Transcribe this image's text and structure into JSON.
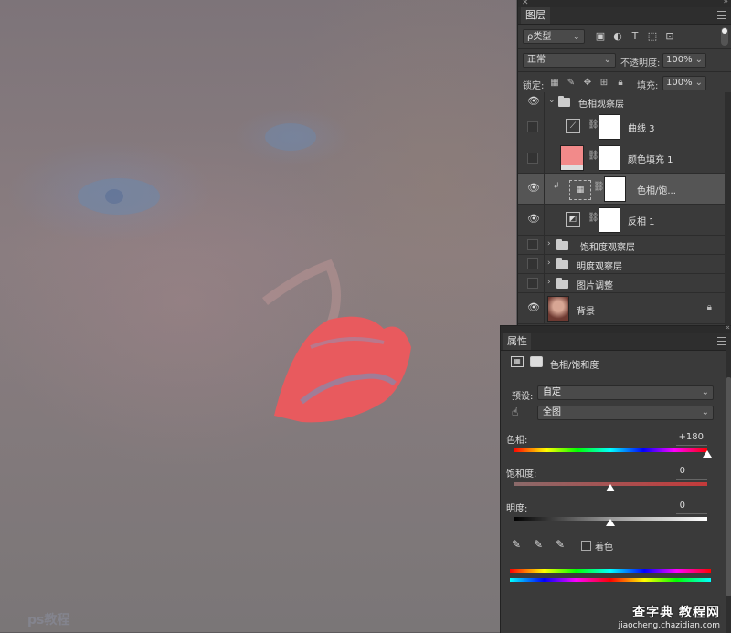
{
  "canvas": {
    "watermark": "ps教程"
  },
  "layers_panel": {
    "tab_label": "图层",
    "filter": {
      "selected": "ρ类型"
    },
    "blend_mode": "正常",
    "opacity_label": "不透明度:",
    "opacity_value": "100%",
    "lock_label": "锁定:",
    "fill_label": "填充:",
    "fill_value": "100%",
    "layers": [
      {
        "name": "色相观察层",
        "kind": "group",
        "visible": true
      },
      {
        "name": "曲线 3",
        "kind": "adjustment",
        "visible": false
      },
      {
        "name": "颜色填充 1",
        "kind": "fill",
        "visible": false,
        "color": "#f28a8a"
      },
      {
        "name": "色相/饱...",
        "kind": "adjustment",
        "visible": true,
        "selected": true
      },
      {
        "name": "反相 1",
        "kind": "adjustment",
        "visible": true
      },
      {
        "name": "饱和度观察层",
        "kind": "group",
        "visible": false
      },
      {
        "name": "明度观察层",
        "kind": "group",
        "visible": false
      },
      {
        "name": "图片调整",
        "kind": "group",
        "visible": false
      },
      {
        "name": "背景",
        "kind": "background",
        "visible": true,
        "locked": true
      }
    ]
  },
  "properties_panel": {
    "tab_label": "属性",
    "title": "色相/饱和度",
    "preset_label": "预设:",
    "preset_value": "自定",
    "channel_value": "全图",
    "hue": {
      "label": "色相:",
      "value": "+180",
      "slider": 1.0
    },
    "saturation": {
      "label": "饱和度:",
      "value": "0",
      "slider": 0.5
    },
    "lightness": {
      "label": "明度:",
      "value": "0",
      "slider": 0.5
    },
    "colorize_label": "着色",
    "colorize_checked": false
  },
  "site_watermark": {
    "big": "查字典 教程网",
    "small": "jiaocheng.chazidian.com"
  }
}
